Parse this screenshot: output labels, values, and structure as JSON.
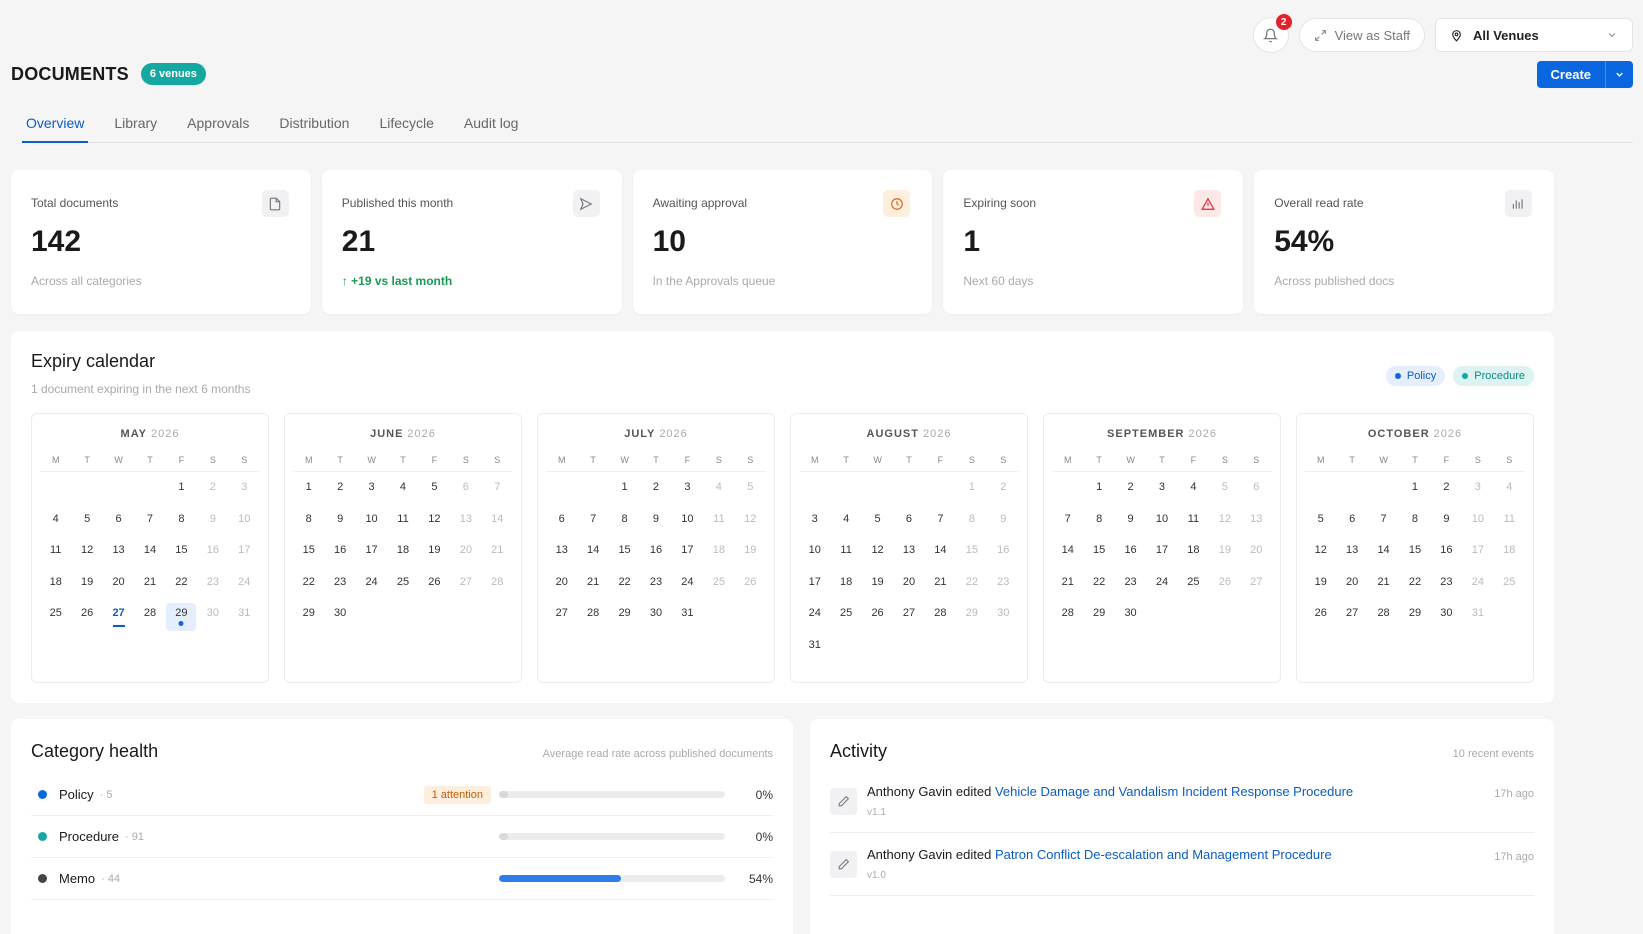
{
  "header": {
    "notifications": "2",
    "view_as_staff": "View as Staff",
    "venue_select": "All Venues",
    "title": "DOCUMENTS",
    "venues_badge": "6 venues",
    "create": "Create"
  },
  "tabs": [
    "Overview",
    "Library",
    "Approvals",
    "Distribution",
    "Lifecycle",
    "Audit log"
  ],
  "kpis": [
    {
      "label": "Total documents",
      "value": "142",
      "sub": "Across all categories",
      "icon": "document-icon"
    },
    {
      "label": "Published this month",
      "value": "21",
      "sub": "+19 vs last month",
      "icon": "send-icon"
    },
    {
      "label": "Awaiting approval",
      "value": "10",
      "sub": "In the Approvals queue",
      "icon": "clock-icon"
    },
    {
      "label": "Expiring soon",
      "value": "1",
      "sub": "Next 60 days",
      "icon": "warning-icon"
    },
    {
      "label": "Overall read rate",
      "value": "54%",
      "sub": "Across published docs",
      "icon": "bar-chart-icon"
    }
  ],
  "calendar": {
    "title": "Expiry calendar",
    "subtitle": "1 document expiring in the next 6 months",
    "legend": [
      {
        "label": "Policy",
        "color": "#0b67e0",
        "bg": "#e4eefc",
        "fg": "#0b5cc5"
      },
      {
        "label": "Procedure",
        "color": "#16a8a0",
        "bg": "#dcf3f1",
        "fg": "#0e8a83"
      }
    ],
    "weekdays": [
      "M",
      "T",
      "W",
      "T",
      "F",
      "S",
      "S"
    ],
    "months": [
      {
        "name": "MAY",
        "year": "2026",
        "offset": 4,
        "days": 31,
        "today": 27,
        "expiry": 29
      },
      {
        "name": "JUNE",
        "year": "2026",
        "offset": 0,
        "days": 30
      },
      {
        "name": "JULY",
        "year": "2026",
        "offset": 2,
        "days": 31
      },
      {
        "name": "AUGUST",
        "year": "2026",
        "offset": 5,
        "days": 31
      },
      {
        "name": "SEPTEMBER",
        "year": "2026",
        "offset": 1,
        "days": 30
      },
      {
        "name": "OCTOBER",
        "year": "2026",
        "offset": 3,
        "days": 31
      }
    ]
  },
  "category_health": {
    "title": "Category health",
    "note": "Average read rate across published documents",
    "rows": [
      {
        "name": "Policy",
        "count": "· 5",
        "color": "#0b67e0",
        "attention": "1 attention",
        "rate": 0,
        "pct": "0%"
      },
      {
        "name": "Procedure",
        "count": "· 91",
        "color": "#16a8a0",
        "attention": "",
        "rate": 0,
        "pct": "0%"
      },
      {
        "name": "Memo",
        "count": "· 44",
        "color": "#444444",
        "attention": "",
        "rate": 54,
        "pct": "54%"
      }
    ]
  },
  "activity": {
    "title": "Activity",
    "note": "10 recent events",
    "items": [
      {
        "who": "Anthony Gavin",
        "verb": "edited",
        "doc": "Vehicle Damage and Vandalism Incident Response Procedure",
        "version": "v1.1",
        "time": "17h ago"
      },
      {
        "who": "Anthony Gavin",
        "verb": "edited",
        "doc": "Patron Conflict De-escalation and Management Procedure",
        "version": "v1.0",
        "time": "17h ago"
      }
    ]
  }
}
